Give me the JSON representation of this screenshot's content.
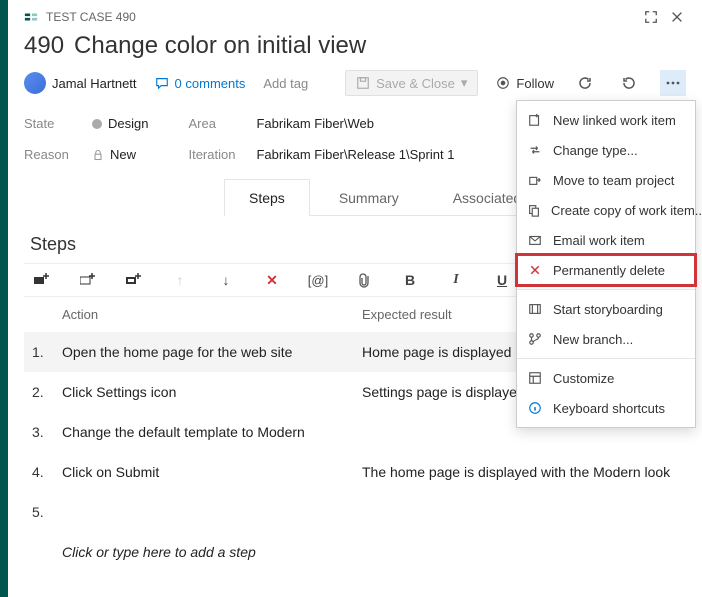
{
  "titlebar": {
    "type_label": "TEST CASE 490"
  },
  "work_item": {
    "id": "490",
    "title": "Change color on initial view"
  },
  "meta": {
    "assignee": "Jamal Hartnett",
    "comments_label": "0 comments",
    "add_tag_label": "Add tag",
    "save_close_label": "Save & Close",
    "follow_label": "Follow"
  },
  "fields": {
    "state_label": "State",
    "state_value": "Design",
    "reason_label": "Reason",
    "reason_value": "New",
    "area_label": "Area",
    "area_value": "Fabrikam Fiber\\Web",
    "iteration_label": "Iteration",
    "iteration_value": "Fabrikam Fiber\\Release 1\\Sprint 1"
  },
  "tabs": {
    "steps": "Steps",
    "summary": "Summary",
    "automation": "Associated Automation"
  },
  "steps_section": {
    "title": "Steps",
    "headers": {
      "action": "Action",
      "expected": "Expected result"
    },
    "rows": [
      {
        "num": "1.",
        "action": "Open the home page for the web site",
        "expected": "Home page is displayed"
      },
      {
        "num": "2.",
        "action": "Click Settings icon",
        "expected": "Settings page is displayed"
      },
      {
        "num": "3.",
        "action": "Change the default template to Modern",
        "expected": ""
      },
      {
        "num": "4.",
        "action": "Click on Submit",
        "expected": "The home page is displayed with the Modern look"
      },
      {
        "num": "5.",
        "action": "",
        "expected": ""
      }
    ],
    "placeholder": "Click or type here to add a step"
  },
  "toolbar_icons": {
    "mention": "[@]",
    "bold": "B",
    "italic": "I",
    "underline": "U"
  },
  "menu": {
    "new_linked": "New linked work item",
    "change_type": "Change type...",
    "move_team": "Move to team project",
    "create_copy": "Create copy of work item...",
    "email": "Email work item",
    "delete": "Permanently delete",
    "storyboard": "Start storyboarding",
    "new_branch": "New branch...",
    "customize": "Customize",
    "shortcuts": "Keyboard shortcuts"
  }
}
